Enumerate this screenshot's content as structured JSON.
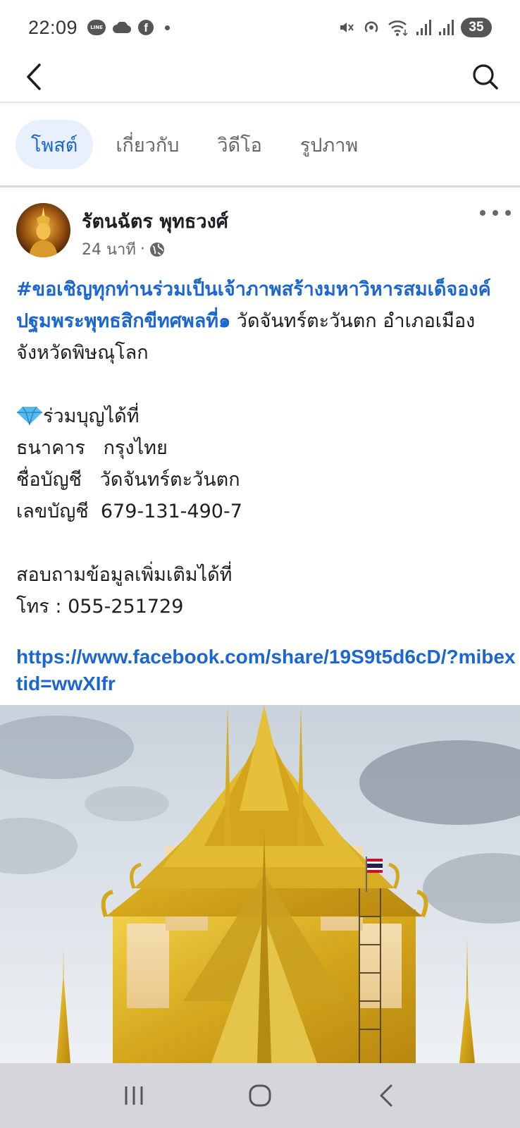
{
  "status_bar": {
    "time": "22:09",
    "line_label": "LINE",
    "battery": "35",
    "icons": [
      "line-icon",
      "cloud-icon",
      "facebook-icon",
      "dot-icon",
      "mute-icon",
      "hotspot-icon",
      "wifi-icon",
      "signal-icon",
      "signal-icon",
      "battery-icon"
    ]
  },
  "nav": {
    "back_icon": "chevron-left-icon",
    "search_icon": "search-icon"
  },
  "tabs": [
    {
      "label": "โพสต์",
      "active": true
    },
    {
      "label": "เกี่ยวกับ",
      "active": false
    },
    {
      "label": "วิดีโอ",
      "active": false
    },
    {
      "label": "รูปภาพ",
      "active": false
    }
  ],
  "post": {
    "author": "รัตนฉัตร พุทธวงศ์",
    "time": "24 นาที",
    "separator": "·",
    "privacy_icon": "globe-icon",
    "hashtag": "#ขอเชิญทุกท่านร่วมเป็นเจ้าภาพสร้างมหาวิหารสมเด็จองค์ปฐมพระพุทธสิกขีทศพลที่๑",
    "intro_rest": " วัดจันทร์ตะวันตก อำเภอเมือง จังหวัดพิษณุโลก",
    "donate_heading": "ร่วมบุญได้ที่",
    "bank_line": "ธนาคาร   กรุงไทย",
    "account_name_line": "ชื่อบัญชี   วัดจันทร์ตะวันตก",
    "account_number_line": "เลขบัญชี  679-131-490-7",
    "contact_line": "สอบถามข้อมูลเพิ่มเติมได้ที่",
    "phone_line": "โทร : 055-251729",
    "link": "https://www.facebook.com/share/19S9t5d6cD/?mibextid=wwXIfr"
  },
  "system_nav": [
    "recent-apps-icon",
    "home-icon",
    "back-icon"
  ]
}
